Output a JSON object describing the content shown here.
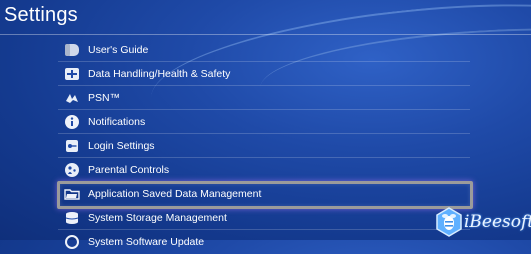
{
  "header": {
    "title": "Settings"
  },
  "menu": {
    "items": [
      {
        "label": "User's Guide",
        "icon": "guide-icon"
      },
      {
        "label": "Data Handling/Health & Safety",
        "icon": "health-safety-icon"
      },
      {
        "label": "PSN™",
        "icon": "psn-icon"
      },
      {
        "label": "Notifications",
        "icon": "info-icon"
      },
      {
        "label": "Login Settings",
        "icon": "key-icon"
      },
      {
        "label": "Parental Controls",
        "icon": "parental-icon"
      },
      {
        "label": "Application Saved Data Management",
        "icon": "folder-icon",
        "selected": true
      },
      {
        "label": "System Storage Management",
        "icon": "storage-icon"
      },
      {
        "label": "System Software Update",
        "icon": "update-icon"
      }
    ]
  },
  "watermark": {
    "text": "iBeesoft"
  },
  "colors": {
    "background": "#1f4aa8",
    "highlight": "#9b9b9b",
    "text": "#ffffff"
  }
}
